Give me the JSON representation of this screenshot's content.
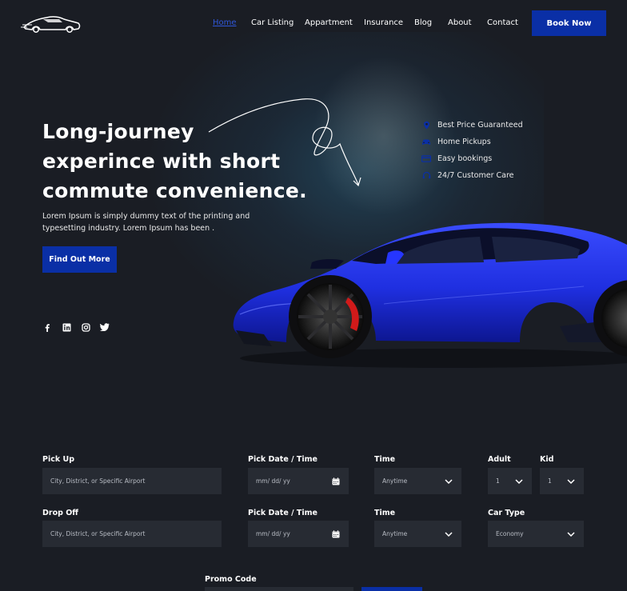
{
  "nav": {
    "items": [
      {
        "label": "Home",
        "active": true
      },
      {
        "label": "Car Listing"
      },
      {
        "label": "Appartment"
      },
      {
        "label": "Insurance"
      },
      {
        "label": "Blog"
      },
      {
        "label": "About"
      },
      {
        "label": "Contact"
      }
    ],
    "book_now": "Book Now"
  },
  "hero": {
    "title_line1": "Long-journey",
    "title_line2": "experince with short",
    "title_line3": "commute convenience.",
    "description": "Lorem Ipsum is simply dummy text of the printing and typesetting industry. Lorem Ipsum has been .",
    "cta": "Find Out More",
    "socials": [
      "facebook-icon",
      "linkedin-icon",
      "instagram-icon",
      "twitter-icon"
    ]
  },
  "features": [
    {
      "icon": "location-pin-icon",
      "label": "Best Price Guaranteed"
    },
    {
      "icon": "car-icon",
      "label": "Home Pickups"
    },
    {
      "icon": "card-icon",
      "label": "Easy bookings"
    },
    {
      "icon": "headset-icon",
      "label": "24/7 Customer Care"
    }
  ],
  "form": {
    "pickup": {
      "label": "Pick Up",
      "placeholder": "City, District, or Specific Airport"
    },
    "pickup_date": {
      "label": "Pick Date / Time",
      "placeholder": "mm/ dd/ yy"
    },
    "pickup_time": {
      "label": "Time",
      "value": "Anytime"
    },
    "adult": {
      "label": "Adult",
      "value": "1"
    },
    "kid": {
      "label": "Kid",
      "value": "1"
    },
    "dropoff": {
      "label": "Drop Off",
      "placeholder": "City, District, or Specific Airport"
    },
    "dropoff_date": {
      "label": "Pick Date / Time",
      "placeholder": "mm/ dd/ yy"
    },
    "dropoff_time": {
      "label": "Time",
      "value": "Anytime"
    },
    "car_type": {
      "label": "Car Type",
      "value": "Economy"
    },
    "promo": {
      "label": "Promo Code"
    }
  },
  "colors": {
    "background": "#1a1d24",
    "accent": "#0a2fa6",
    "field": "#272b33",
    "active_nav": "#2f56d8",
    "car": "#1f2fe0"
  }
}
